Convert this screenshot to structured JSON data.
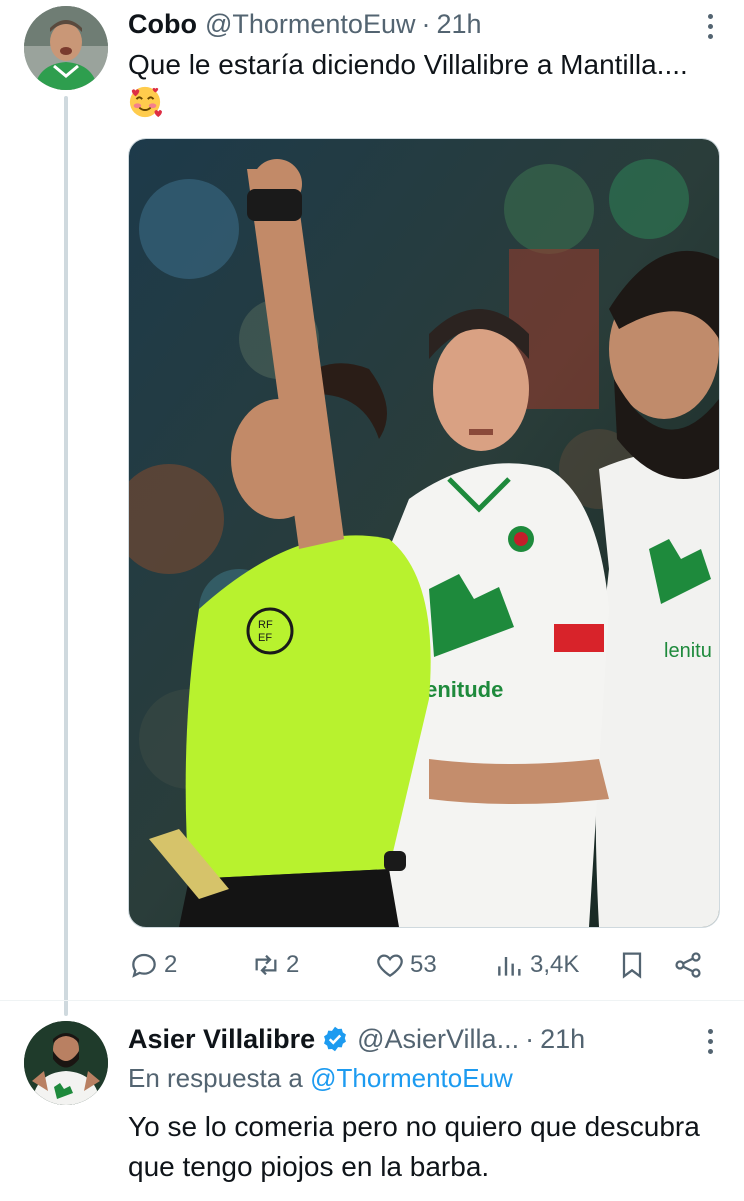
{
  "tweets": [
    {
      "name": "Cobo",
      "handle": "@ThormentoEuw",
      "separator": "·",
      "time": "21h",
      "text": "Que le estaría diciendo Villalibre a Mantilla....",
      "emoji": "smiling-face-with-hearts",
      "image_description": "referee raising arm with two Racing Santander players",
      "actions": {
        "replies": "2",
        "retweets": "2",
        "likes": "53",
        "views": "3,4K"
      }
    },
    {
      "name": "Asier Villalibre",
      "verified": true,
      "handle": "@AsierVilla...",
      "separator": "·",
      "time": "21h",
      "reply_prefix": "En respuesta a",
      "reply_handle": "@ThormentoEuw",
      "text": "Yo se lo comeria pero no quiero que descubra que tengo piojos en la barba."
    }
  ],
  "colors": {
    "accent": "#1d9bf0",
    "muted": "#536471",
    "text": "#0f1419",
    "referee_shirt": "#b8f22e",
    "racing_green": "#1e8a3c"
  }
}
